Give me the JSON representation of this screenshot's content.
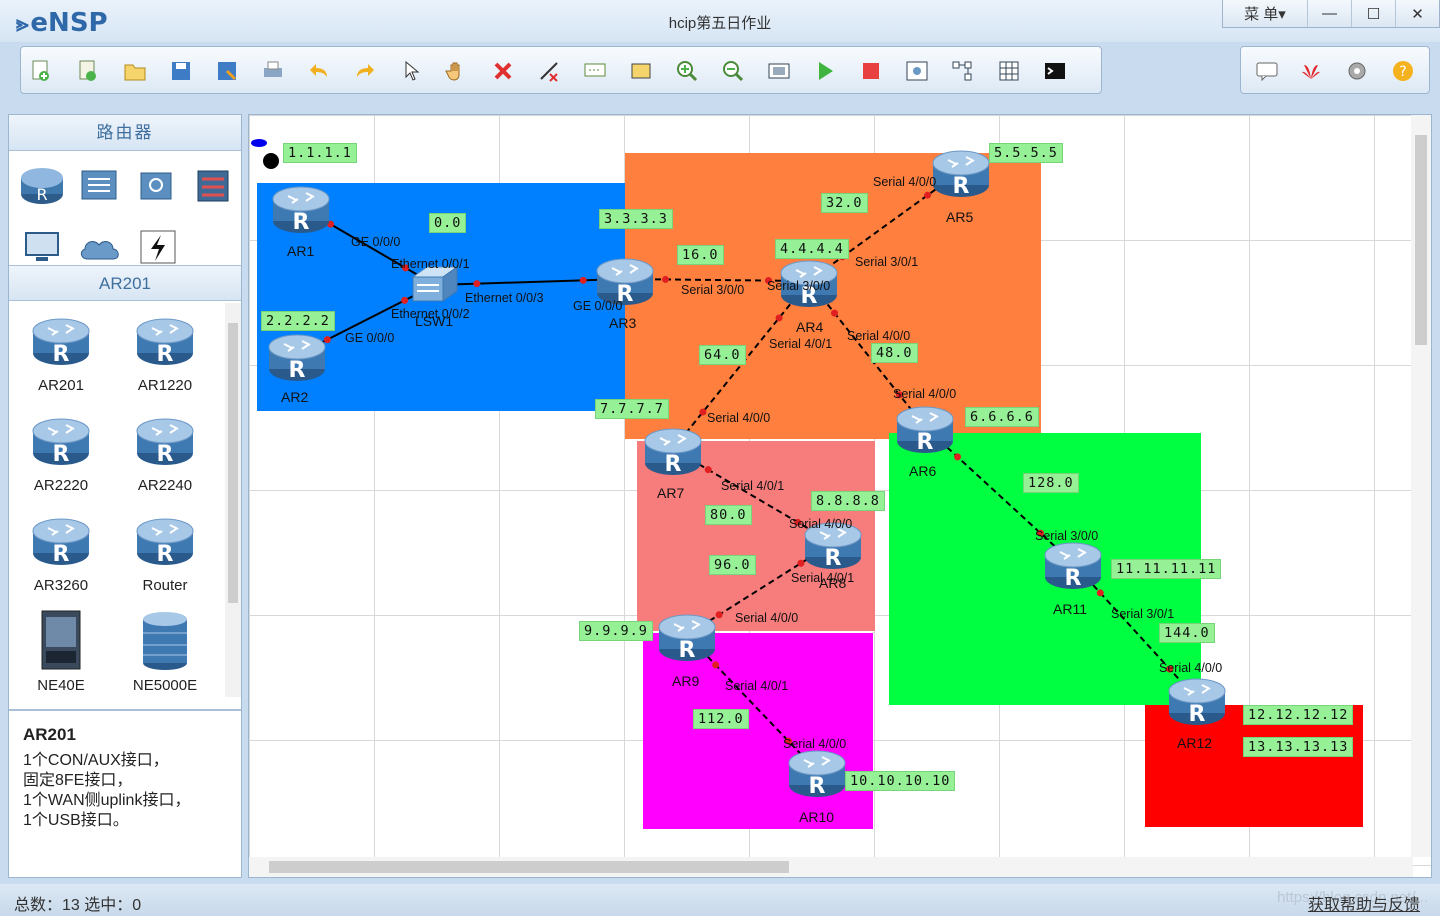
{
  "app": {
    "name": "eNSP",
    "window_title": "hcip第五日作业",
    "menu_label": "菜 单▾"
  },
  "window_controls": {
    "minimize": "—",
    "maximize": "☐",
    "close": "✕"
  },
  "toolbar": {
    "buttons": [
      "new-topology",
      "new-example",
      "open",
      "save",
      "save-as",
      "print",
      "undo",
      "redo",
      "select",
      "pan",
      "delete",
      "delete-links",
      "text",
      "palette",
      "zoom-in",
      "zoom-out",
      "fit",
      "start-all",
      "stop-all",
      "capture",
      "topology-view",
      "table-view",
      "terminal"
    ],
    "right_buttons": [
      "chat",
      "huawei",
      "settings",
      "help"
    ]
  },
  "left_panel": {
    "header": "路由器",
    "categories": [
      "router",
      "switch",
      "wireless",
      "firewall",
      "pc",
      "cloud",
      "power"
    ],
    "sub_header": "AR201",
    "devices": [
      {
        "label": "AR201"
      },
      {
        "label": "AR1220"
      },
      {
        "label": "AR2220"
      },
      {
        "label": "AR2240"
      },
      {
        "label": "AR3260"
      },
      {
        "label": "Router"
      },
      {
        "label": "NE40E"
      },
      {
        "label": "NE5000E"
      }
    ],
    "description": {
      "title": "AR201",
      "lines": [
        "1个CON/AUX接口，",
        "固定8FE接口，",
        "1个WAN侧uplink接口，",
        "1个USB接口。"
      ]
    }
  },
  "topology": {
    "areas": [
      {
        "color": "#0080ff"
      },
      {
        "color": "#ff7f3f"
      },
      {
        "color": "#f77c7c"
      },
      {
        "color": "#00ff40"
      },
      {
        "color": "#ff00ff"
      },
      {
        "color": "#ff0000"
      }
    ],
    "routers": [
      {
        "name": "AR1"
      },
      {
        "name": "AR2"
      },
      {
        "name": "AR3"
      },
      {
        "name": "AR4"
      },
      {
        "name": "AR5"
      },
      {
        "name": "AR6"
      },
      {
        "name": "AR7"
      },
      {
        "name": "AR8"
      },
      {
        "name": "AR9"
      },
      {
        "name": "AR10"
      },
      {
        "name": "AR11"
      },
      {
        "name": "AR12"
      }
    ],
    "switch": {
      "name": "LSW1"
    },
    "tags": [
      "1.1.1.1",
      "0.0",
      "2.2.2.2",
      "3.3.3.3",
      "16.0",
      "4.4.4.4",
      "32.0",
      "5.5.5.5",
      "64.0",
      "48.0",
      "7.7.7.7",
      "6.6.6.6",
      "128.0",
      "8.8.8.8",
      "80.0",
      "96.0",
      "11.11.11.11",
      "9.9.9.9",
      "144.0",
      "112.0",
      "12.12.12.12",
      "13.13.13.13",
      "10.10.10.10"
    ],
    "interfaces": [
      "GE 0/0/0",
      "Ethernet 0/0/1",
      "Ethernet 0/0/3",
      "GE 0/0/0",
      "Ethernet 0/0/2",
      "GE 0/0/0",
      "Serial 3/0/0",
      "Serial 3/0/0",
      "Serial 4/0/0",
      "Serial 3/0/1",
      "Serial 4/0/1",
      "Serial 4/0/0",
      "Serial 4/0/0",
      "Serial 4/0/0",
      "Serial 4/0/1",
      "Serial 4/0/0",
      "Serial 4/0/1",
      "Serial 4/0/0",
      "Serial 4/0/1",
      "Serial 4/0/0",
      "Serial 3/0/0",
      "Serial 3/0/1",
      "Serial 4/0/0"
    ]
  },
  "status": {
    "left": "总数：13  选中：0",
    "right": "获取帮助与反馈",
    "watermark": "https://blog.csdn.net/..."
  }
}
